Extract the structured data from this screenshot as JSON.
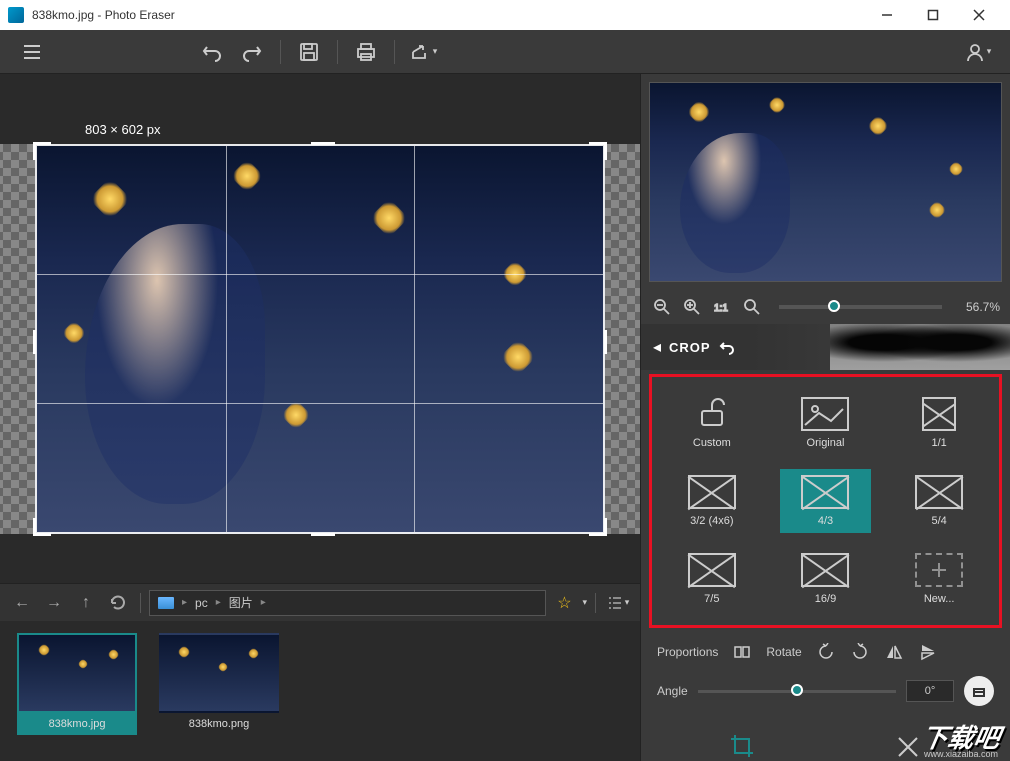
{
  "window": {
    "title": "838kmo.jpg - Photo Eraser"
  },
  "canvas": {
    "dimensions": "803 × 602 px"
  },
  "path": {
    "pc": "pc",
    "pictures": "图片"
  },
  "thumbs": [
    {
      "name": "838kmo.jpg",
      "active": true
    },
    {
      "name": "838kmo.png",
      "active": false
    }
  ],
  "zoom": {
    "value": "56.7%"
  },
  "section": {
    "title": "CROP"
  },
  "crop_options": [
    {
      "label": "Custom",
      "type": "custom"
    },
    {
      "label": "Original",
      "type": "original"
    },
    {
      "label": "1/1",
      "type": "diag-sq"
    },
    {
      "label": "3/2 (4x6)",
      "type": "diag"
    },
    {
      "label": "4/3",
      "type": "diag",
      "selected": true
    },
    {
      "label": "5/4",
      "type": "diag"
    },
    {
      "label": "7/5",
      "type": "diag"
    },
    {
      "label": "16/9",
      "type": "diag"
    },
    {
      "label": "New...",
      "type": "plus"
    }
  ],
  "transform": {
    "proportions": "Proportions",
    "rotate": "Rotate",
    "angle_label": "Angle",
    "angle_value": "0°"
  },
  "watermark": {
    "main": "下载吧",
    "sub": "www.xiazaiba.com"
  }
}
